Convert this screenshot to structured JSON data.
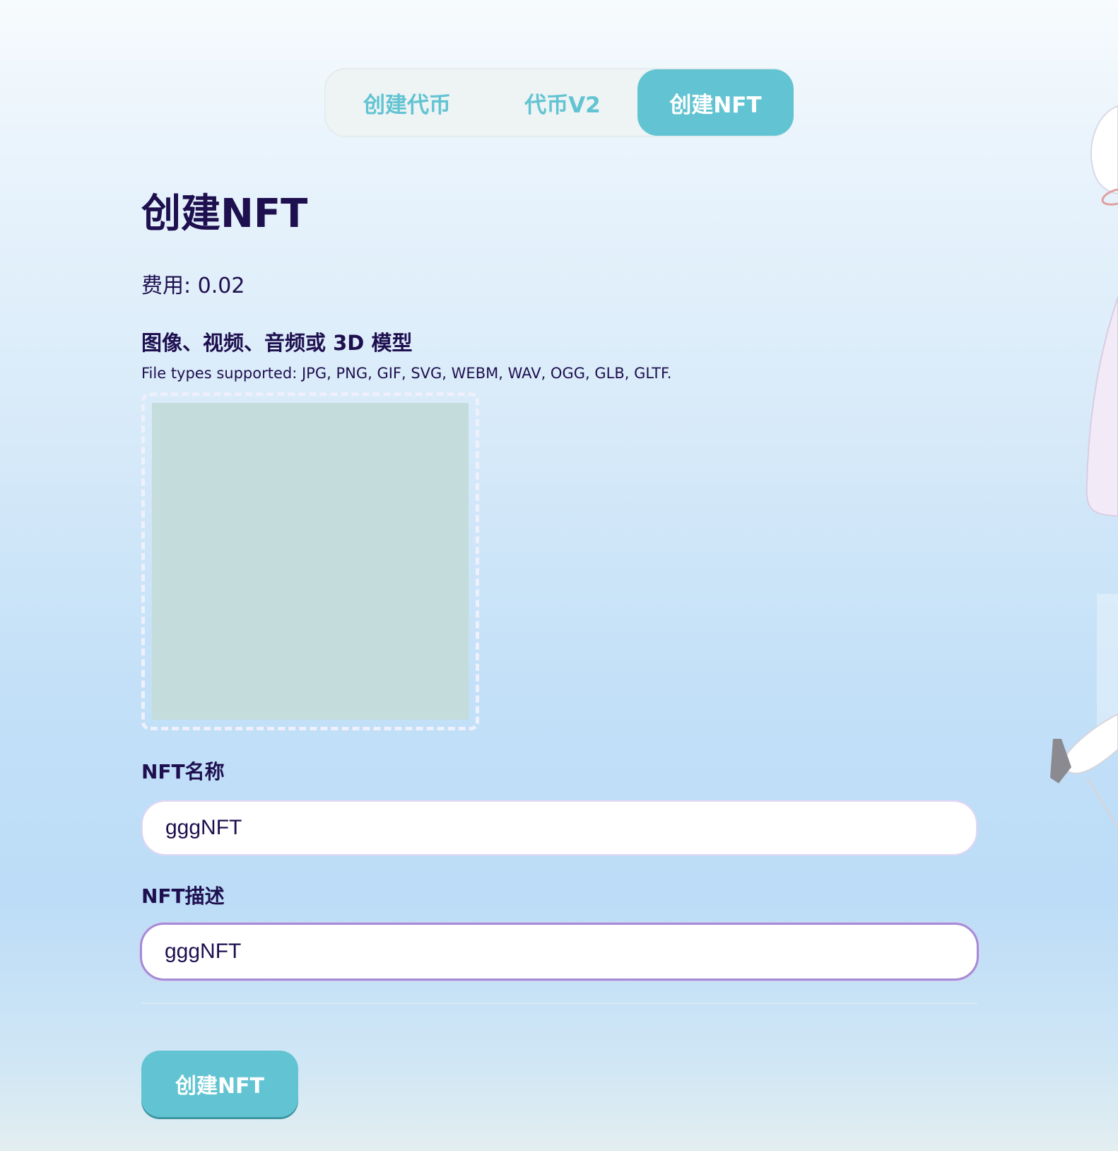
{
  "tabs": [
    {
      "label": "创建代币",
      "active": false
    },
    {
      "label": "代币V2",
      "active": false
    },
    {
      "label": "创建NFT",
      "active": true
    }
  ],
  "page": {
    "title": "创建NFT",
    "fee": "费用: 0.02"
  },
  "media": {
    "heading": "图像、视频、音频或 3D 模型",
    "file_types": "File types supported: JPG, PNG, GIF, SVG, WEBM, WAV, OGG, GLB, GLTF."
  },
  "form": {
    "name_label": "NFT名称",
    "name_value": "gggNFT",
    "description_label": "NFT描述",
    "description_value": "gggNFT"
  },
  "submit_label": "创建NFT",
  "colors": {
    "accent": "#62c4d2",
    "text": "#1e0f4f",
    "focus_border": "#a48bd6",
    "preview": "#c4dcdc"
  }
}
